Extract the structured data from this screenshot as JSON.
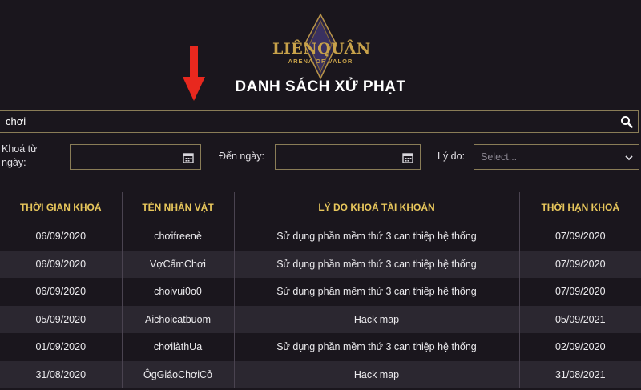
{
  "logo": {
    "main": "LIÊNQUÂN",
    "sub": "ARENA OF VALOR"
  },
  "page_title": "DANH SÁCH XỬ PHẠT",
  "search": {
    "value": "chơi"
  },
  "filters": {
    "from_label_line1": "Khoá từ",
    "from_label_line2": "ngày:",
    "to_label": "Đến ngày:",
    "reason_label": "Lý do:",
    "reason_placeholder": "Select..."
  },
  "table": {
    "headers": [
      "THỜI GIAN KHOÁ",
      "TÊN NHÂN VẬT",
      "LÝ DO KHOÁ TÀI KHOẢN",
      "THỜI HẠN KHOÁ"
    ],
    "rows": [
      [
        "06/09/2020",
        "chơifreenè",
        "Sử dụng phần mềm thứ 3 can thiệp hệ thống",
        "07/09/2020"
      ],
      [
        "06/09/2020",
        "VợCấmChơi",
        "Sử dụng phần mềm thứ 3 can thiệp hệ thống",
        "07/09/2020"
      ],
      [
        "06/09/2020",
        "choivui0o0",
        "Sử dụng phần mềm thứ 3 can thiệp hệ thống",
        "07/09/2020"
      ],
      [
        "05/09/2020",
        "Aichoicatbuom",
        "Hack map",
        "05/09/2021"
      ],
      [
        "01/09/2020",
        "chơilàthUa",
        "Sử dụng phần mềm thứ 3 can thiệp hệ thống",
        "02/09/2020"
      ],
      [
        "31/08/2020",
        "ÔgGiáoChơiCỏ",
        "Hack map",
        "31/08/2021"
      ]
    ]
  },
  "icons": {
    "search": "search-icon",
    "calendar": "calendar-icon",
    "chevron": "chevron-down-icon",
    "arrow": "arrow-down-icon"
  },
  "colors": {
    "accent_gold": "#e8c75c",
    "arrow_red": "#e8281e",
    "background": "#1a161d"
  }
}
